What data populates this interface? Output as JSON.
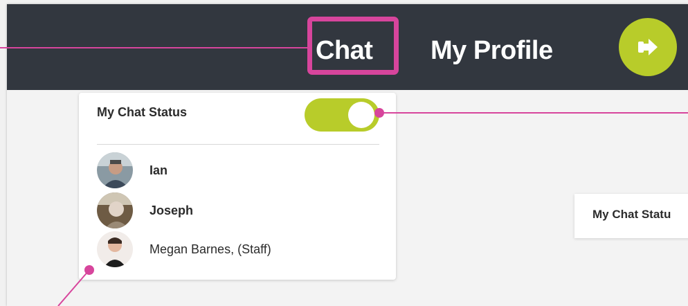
{
  "nav": {
    "chat_label": "Chat",
    "profile_label": "My Profile",
    "logout_icon": "logout-arrow-icon"
  },
  "status_panel": {
    "title": "My Chat Status",
    "toggle_on": true,
    "contacts": [
      {
        "name": "Ian",
        "bold": true
      },
      {
        "name": "Joseph",
        "bold": true
      },
      {
        "name": "Megan Barnes, (Staff)",
        "bold": false
      }
    ]
  },
  "status_card": {
    "label": "My Chat Statu"
  },
  "colors": {
    "topbar": "#32373f",
    "accent_green": "#b8cc2a",
    "callout_pink": "#d7459c",
    "page_bg": "#f3f3f3"
  }
}
